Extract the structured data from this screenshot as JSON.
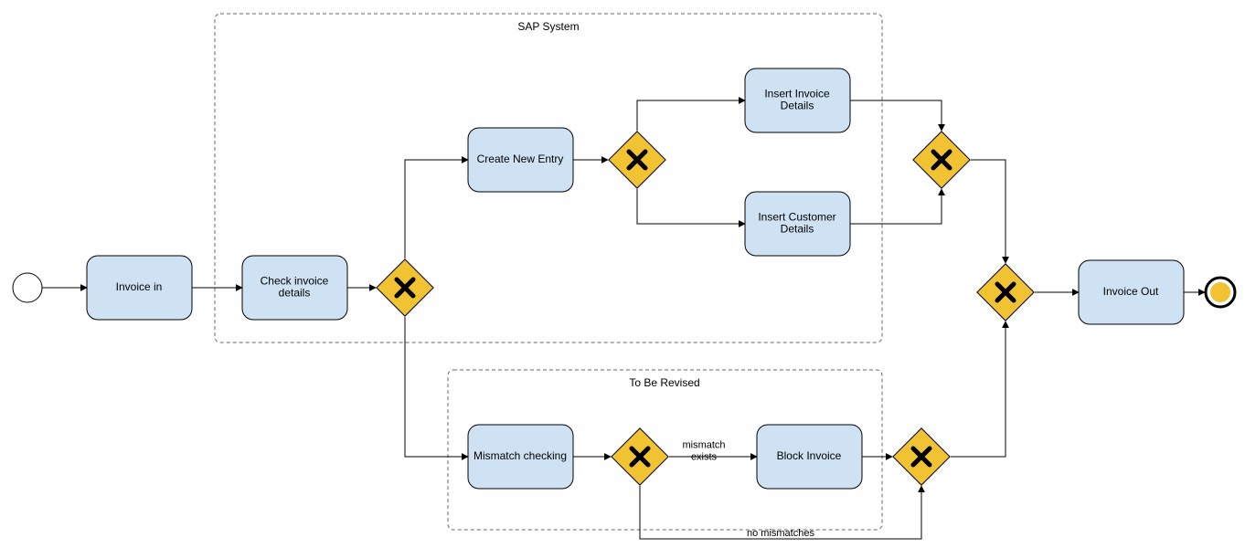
{
  "lanes": {
    "sap": {
      "title": "SAP System"
    },
    "tobe": {
      "title": "To Be Revised"
    }
  },
  "tasks": {
    "invoice_in": "Invoice in",
    "check_invoice": "Check invoice\ndetails",
    "create_new_entry": "Create New Entry",
    "insert_invoice": "Insert Invoice\nDetails",
    "insert_customer": "Insert Customer\nDetails",
    "mismatch_checking": "Mismatch checking",
    "block_invoice": "Block Invoice",
    "invoice_out": "Invoice Out"
  },
  "edges": {
    "mismatch_exists": "mismatch\nexists",
    "no_mismatches": "no mismatches"
  }
}
